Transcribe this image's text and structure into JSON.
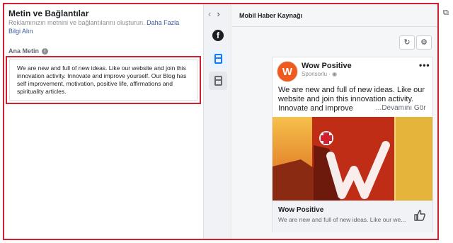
{
  "left": {
    "title": "Metin ve Bağlantılar",
    "description": "Reklamınızın metnini ve bağlantılarını oluşturun.",
    "learn_more": "Daha Fazla Bilgi Alın",
    "primary_text_label": "Ana Metin",
    "primary_text_value": "We are new and full of new ideas. Like our website and join this innovation activity. Innovate and improve yourself. Our Blog has self improvement, motivation, positive life, affirmations and spirituality articles."
  },
  "preview": {
    "title": "Mobil Haber Kaynağı",
    "page_name": "Wow Positive",
    "sponsored": "Sponsorlu · ",
    "post_text": "We are new and full of new ideas. Like our website and join this innovation activity. Innovate and improve",
    "see_more": "...Devamını Gör",
    "link_title": "Wow Positive",
    "link_desc": "We are new and full of new ideas. Like our we..."
  },
  "colors": {
    "highlight_border": "#d1202f",
    "brand_orange": "#ef5a1f",
    "link_blue": "#385898",
    "active_blue": "#1877f2"
  },
  "icons": {
    "nav_prev": "chevron-left-icon",
    "nav_next": "chevron-right-icon",
    "facebook": "facebook-icon",
    "feed": "mobile-feed-icon",
    "story": "mobile-story-icon",
    "refresh": "refresh-icon",
    "bug": "bug-icon",
    "like": "thumbs-up-icon",
    "more": "more-options-icon",
    "info": "info-icon"
  }
}
